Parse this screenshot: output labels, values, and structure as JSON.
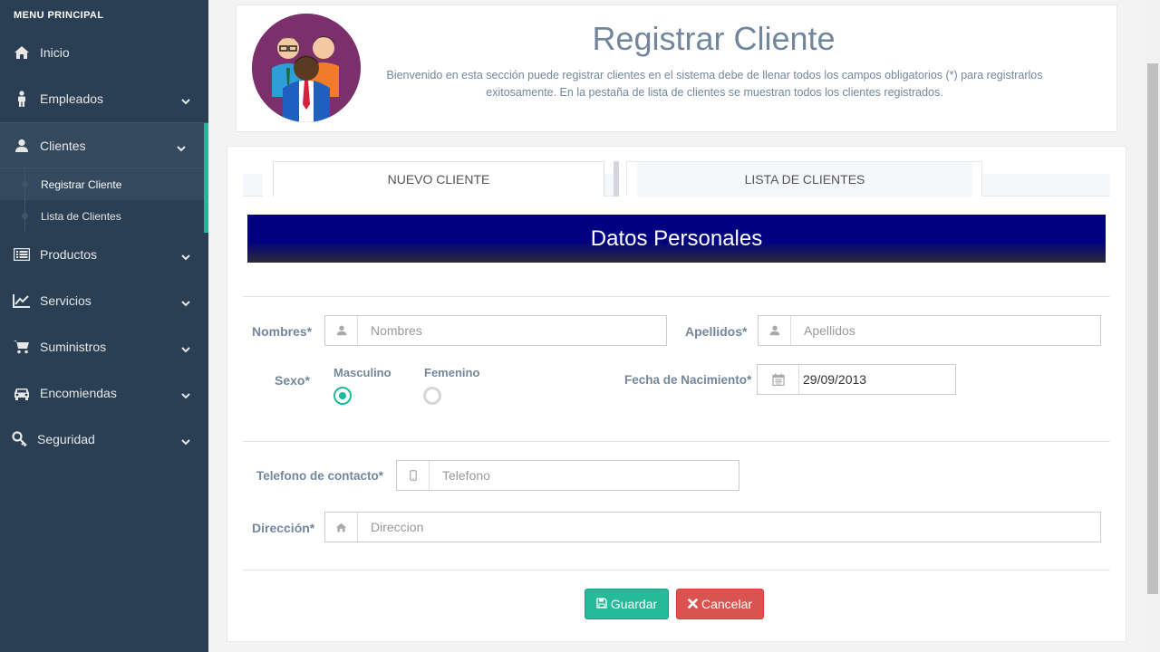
{
  "sidebar": {
    "menu_title": "MENU PRINCIPAL",
    "items": [
      {
        "label": "Inicio",
        "icon": "home-icon"
      },
      {
        "label": "Empleados",
        "icon": "person-icon"
      },
      {
        "label": "Clientes",
        "icon": "user-icon"
      },
      {
        "label": "Productos",
        "icon": "list-icon"
      },
      {
        "label": "Servicios",
        "icon": "line-chart-icon"
      },
      {
        "label": "Suministros",
        "icon": "cart-icon"
      },
      {
        "label": "Encomiendas",
        "icon": "car-icon"
      },
      {
        "label": "Seguridad",
        "icon": "key-icon"
      }
    ],
    "subitems": [
      {
        "label": "Registrar Cliente"
      },
      {
        "label": "Lista de Clientes"
      }
    ]
  },
  "header": {
    "title": "Registrar Cliente",
    "intro": "Bienvenido en esta sección puede registrar clientes en el sistema debe de llenar todos los campos obligatorios (*) para registrarlos exitosamente. En la pestaña de lista de clientes se muestran todos los clientes registrados."
  },
  "tabs": [
    {
      "label": "NUEVO CLIENTE"
    },
    {
      "label": "LISTA DE CLIENTES"
    }
  ],
  "form": {
    "section_title": "Datos Personales",
    "nombres": {
      "label": "Nombres*",
      "placeholder": "Nombres"
    },
    "apellidos": {
      "label": "Apellidos*",
      "placeholder": "Apellidos"
    },
    "sexo": {
      "label": "Sexo*",
      "option_m": "Masculino",
      "option_f": "Femenino",
      "selected": "Masculino"
    },
    "fecha": {
      "label": "Fecha de Nacimiento*",
      "value": "29/09/2013"
    },
    "telefono": {
      "label": "Telefono de contacto*",
      "placeholder": "Telefono"
    },
    "direccion": {
      "label": "Dirección*",
      "placeholder": "Direccion"
    }
  },
  "buttons": {
    "save": "Guardar",
    "cancel": "Cancelar"
  },
  "colors": {
    "sidebar": "#2a3f54",
    "accent": "#1abb9c",
    "banner": "#000080",
    "save": "#26b99a",
    "cancel": "#d9534f"
  }
}
